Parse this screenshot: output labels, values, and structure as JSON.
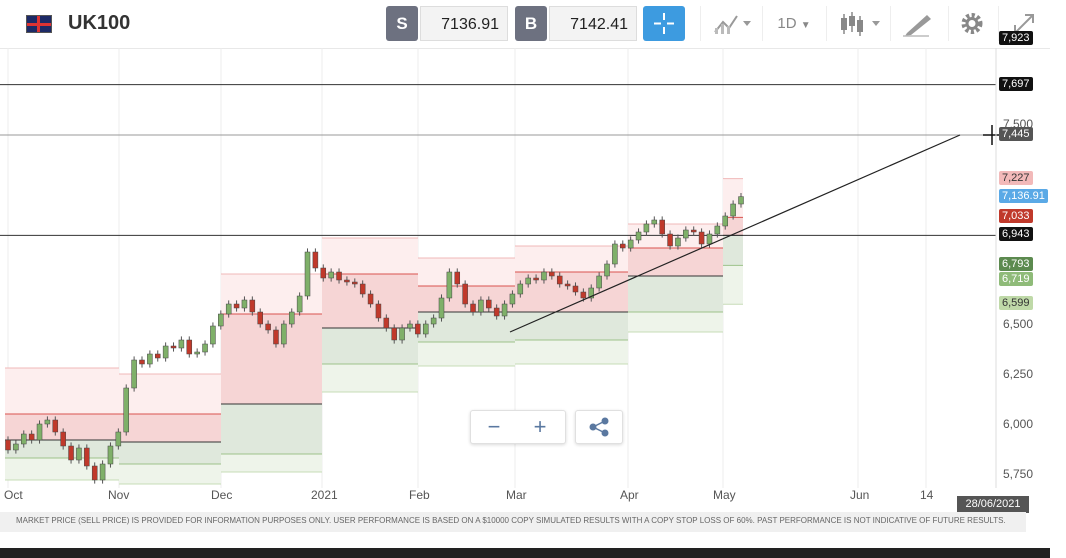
{
  "header": {
    "symbol": "UK100",
    "sell_letter": "S",
    "sell_price": "7136.91",
    "buy_letter": "B",
    "buy_price": "7142.41",
    "timeframe": "1D"
  },
  "icons": [
    "flag-icon",
    "crosshair-icon",
    "chart-type-icon",
    "candlestick-icon",
    "draw-icon",
    "gear-icon",
    "expand-icon",
    "minus-icon",
    "plus-icon",
    "share-icon"
  ],
  "colors": {
    "accent": "#3d9be0",
    "bull": "#7fb069",
    "bear": "#c0392b",
    "upper_zone": "#f6d5d5",
    "lower_zone": "#dde8dc"
  },
  "price_labels": [
    {
      "text": "7,923",
      "value": 7923,
      "bg": "#111"
    },
    {
      "text": "7,697",
      "value": 7697,
      "bg": "#111"
    },
    {
      "text": "7,445",
      "value": 7445,
      "bg": "#555"
    },
    {
      "text": "7,227",
      "value": 7227,
      "bg": "#f2b9b9"
    },
    {
      "text": "7,136.91",
      "value": 7136.91,
      "bg": "#5aa9e6"
    },
    {
      "text": "7,033",
      "value": 7033,
      "bg": "#c0392b"
    },
    {
      "text": "6,943",
      "value": 6943,
      "bg": "#111"
    },
    {
      "text": "6,793",
      "value": 6793,
      "bg": "#5c8a4f"
    },
    {
      "text": "6,719",
      "value": 6719,
      "bg": "#8fbb79"
    },
    {
      "text": "6,599",
      "value": 6599,
      "bg": "#bfd9a8"
    }
  ],
  "date_badge": "28/06/2021",
  "footer_text": "MARKET PRICE (SELL PRICE) IS PROVIDED FOR INFORMATION PURPOSES ONLY. USER PERFORMANCE IS BASED ON A $10000 COPY SIMULATED RESULTS WITH A COPY STOP LOSS OF 60%. PAST PERFORMANCE IS NOT INDICATIVE OF FUTURE RESULTS.",
  "chart_data": {
    "type": "candlestick",
    "title": "",
    "ylim": [
      5700,
      7960
    ],
    "y_ticks": [
      5750,
      6000,
      6250,
      6500,
      7500
    ],
    "y_tick_labels": [
      "5,750",
      "6,000",
      "6,250",
      "6,500",
      "7,500"
    ],
    "x_ticks": [
      "Oct",
      "Nov",
      "Dec",
      "2021",
      "Feb",
      "Mar",
      "Apr",
      "May",
      "Jun",
      "14"
    ],
    "horizontal_lines": [
      7697,
      7445,
      6943
    ],
    "trendline": {
      "from": [
        "2021-02-26",
        6460
      ],
      "to": [
        "2021-06-24",
        7445
      ]
    },
    "monthly_pivot_zones": [
      {
        "month": "Oct",
        "r2": 6280,
        "r1": 6050,
        "p": 5920,
        "s1": 5830,
        "s2": 5720
      },
      {
        "month": "Nov",
        "r2": 6250,
        "r1": 6050,
        "p": 5910,
        "s1": 5800,
        "s2": 5700
      },
      {
        "month": "Dec",
        "r2": 6750,
        "r1": 6550,
        "p": 6100,
        "s1": 5850,
        "s2": 5760
      },
      {
        "month": "Jan",
        "r2": 6930,
        "r1": 6750,
        "p": 6480,
        "s1": 6300,
        "s2": 6160
      },
      {
        "month": "Feb",
        "r2": 6830,
        "r1": 6690,
        "p": 6560,
        "s1": 6410,
        "s2": 6290
      },
      {
        "month": "Mar",
        "r2": 6890,
        "r1": 6760,
        "p": 6560,
        "s1": 6420,
        "s2": 6300
      },
      {
        "month": "Apr",
        "r2": 7000,
        "r1": 6880,
        "p": 6740,
        "s1": 6560,
        "s2": 6460
      },
      {
        "month": "May",
        "r2": 7227,
        "r1": 7033,
        "p": 6943,
        "s1": 6793,
        "s2": 6599
      }
    ],
    "series": [
      {
        "values": [
          [
            5920,
            5870
          ],
          [
            5870,
            5900
          ],
          [
            5900,
            5950
          ],
          [
            5950,
            5920
          ],
          [
            5920,
            6000
          ],
          [
            6000,
            6020
          ],
          [
            6020,
            5960
          ],
          [
            5960,
            5890
          ],
          [
            5890,
            5820
          ],
          [
            5820,
            5880
          ],
          [
            5880,
            5790
          ],
          [
            5790,
            5720
          ],
          [
            5720,
            5800
          ],
          [
            5800,
            5890
          ],
          [
            5890,
            5960
          ],
          [
            5960,
            6180
          ],
          [
            6180,
            6320
          ],
          [
            6320,
            6300
          ],
          [
            6300,
            6350
          ],
          [
            6350,
            6330
          ],
          [
            6330,
            6390
          ],
          [
            6390,
            6380
          ],
          [
            6380,
            6420
          ],
          [
            6420,
            6350
          ],
          [
            6350,
            6360
          ],
          [
            6360,
            6400
          ],
          [
            6400,
            6490
          ],
          [
            6490,
            6550
          ],
          [
            6550,
            6600
          ],
          [
            6600,
            6580
          ],
          [
            6580,
            6620
          ],
          [
            6620,
            6560
          ],
          [
            6560,
            6500
          ],
          [
            6500,
            6470
          ],
          [
            6470,
            6400
          ],
          [
            6400,
            6500
          ],
          [
            6500,
            6560
          ],
          [
            6560,
            6640
          ],
          [
            6640,
            6860
          ],
          [
            6860,
            6780
          ],
          [
            6780,
            6730
          ],
          [
            6730,
            6760
          ],
          [
            6760,
            6720
          ],
          [
            6720,
            6710
          ],
          [
            6710,
            6700
          ],
          [
            6700,
            6650
          ],
          [
            6650,
            6600
          ],
          [
            6600,
            6530
          ],
          [
            6530,
            6480
          ],
          [
            6480,
            6420
          ],
          [
            6420,
            6480
          ],
          [
            6480,
            6500
          ],
          [
            6500,
            6450
          ],
          [
            6450,
            6500
          ],
          [
            6500,
            6530
          ],
          [
            6530,
            6630
          ],
          [
            6630,
            6760
          ],
          [
            6760,
            6700
          ],
          [
            6700,
            6600
          ],
          [
            6600,
            6560
          ],
          [
            6560,
            6620
          ],
          [
            6620,
            6580
          ],
          [
            6580,
            6540
          ],
          [
            6540,
            6600
          ],
          [
            6600,
            6650
          ],
          [
            6650,
            6700
          ],
          [
            6700,
            6730
          ],
          [
            6730,
            6720
          ],
          [
            6720,
            6760
          ],
          [
            6760,
            6740
          ],
          [
            6740,
            6700
          ],
          [
            6700,
            6690
          ],
          [
            6690,
            6660
          ],
          [
            6660,
            6630
          ],
          [
            6630,
            6680
          ],
          [
            6680,
            6740
          ],
          [
            6740,
            6800
          ],
          [
            6800,
            6900
          ],
          [
            6900,
            6880
          ],
          [
            6880,
            6920
          ],
          [
            6920,
            6960
          ],
          [
            6960,
            7000
          ],
          [
            7000,
            7020
          ],
          [
            7020,
            6950
          ],
          [
            6950,
            6890
          ],
          [
            6890,
            6930
          ],
          [
            6930,
            6970
          ],
          [
            6970,
            6960
          ],
          [
            6960,
            6900
          ],
          [
            6900,
            6950
          ],
          [
            6950,
            6990
          ],
          [
            6990,
            7040
          ],
          [
            7040,
            7100
          ],
          [
            7100,
            7136.91
          ]
        ]
      }
    ]
  }
}
